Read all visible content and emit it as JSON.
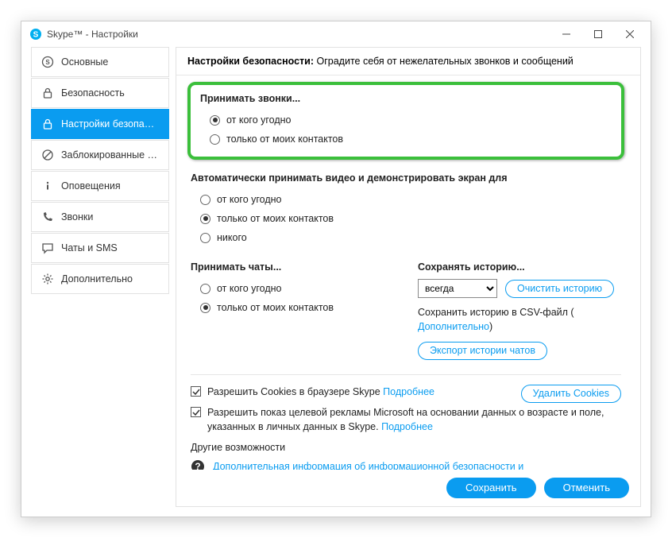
{
  "title": "Skype™ - Настройки",
  "sidebar": [
    {
      "label": "Основные"
    },
    {
      "label": "Безопасность"
    },
    {
      "label": "Настройки безопасно..."
    },
    {
      "label": "Заблокированные по..."
    },
    {
      "label": "Оповещения"
    },
    {
      "label": "Звонки"
    },
    {
      "label": "Чаты и SMS"
    },
    {
      "label": "Дополнительно"
    }
  ],
  "header": {
    "title": "Настройки безопасности: ",
    "desc": "Оградите себя от нежелательных звонков и сообщений"
  },
  "sections": {
    "calls": {
      "title": "Принимать звонки...",
      "opts": [
        "от кого угодно",
        "только от моих контактов"
      ],
      "selected": 0
    },
    "video": {
      "title": "Автоматически принимать видео и демонстрировать экран для",
      "opts": [
        "от кого угодно",
        "только от моих контактов",
        "никого"
      ],
      "selected": 1
    },
    "chats": {
      "title": "Принимать чаты...",
      "opts": [
        "от кого угодно",
        "только от моих контактов"
      ],
      "selected": 1
    },
    "history": {
      "title": "Сохранять историю...",
      "select_value": "всегда",
      "clear_btn": "Очистить историю",
      "csv_text": "Сохранить историю в CSV-файл (",
      "csv_link": "Дополнительно",
      "export_btn": "Экспорт истории чатов"
    }
  },
  "cookies": {
    "check1": "Разрешить Cookies в браузере Skype ",
    "more": "Подробнее",
    "delete_btn": "Удалить Cookies"
  },
  "ads": {
    "text": "Разрешить показ целевой рекламы Microsoft на основании данных о возрасте и поле, указанных в личных данных в Skype. ",
    "more": "Подробнее"
  },
  "other": {
    "title": "Другие возможности",
    "link": "Дополнительная информация об информационной безопасности и конфиденциальности данных в Skype"
  },
  "footer": {
    "save": "Сохранить",
    "cancel": "Отменить"
  }
}
